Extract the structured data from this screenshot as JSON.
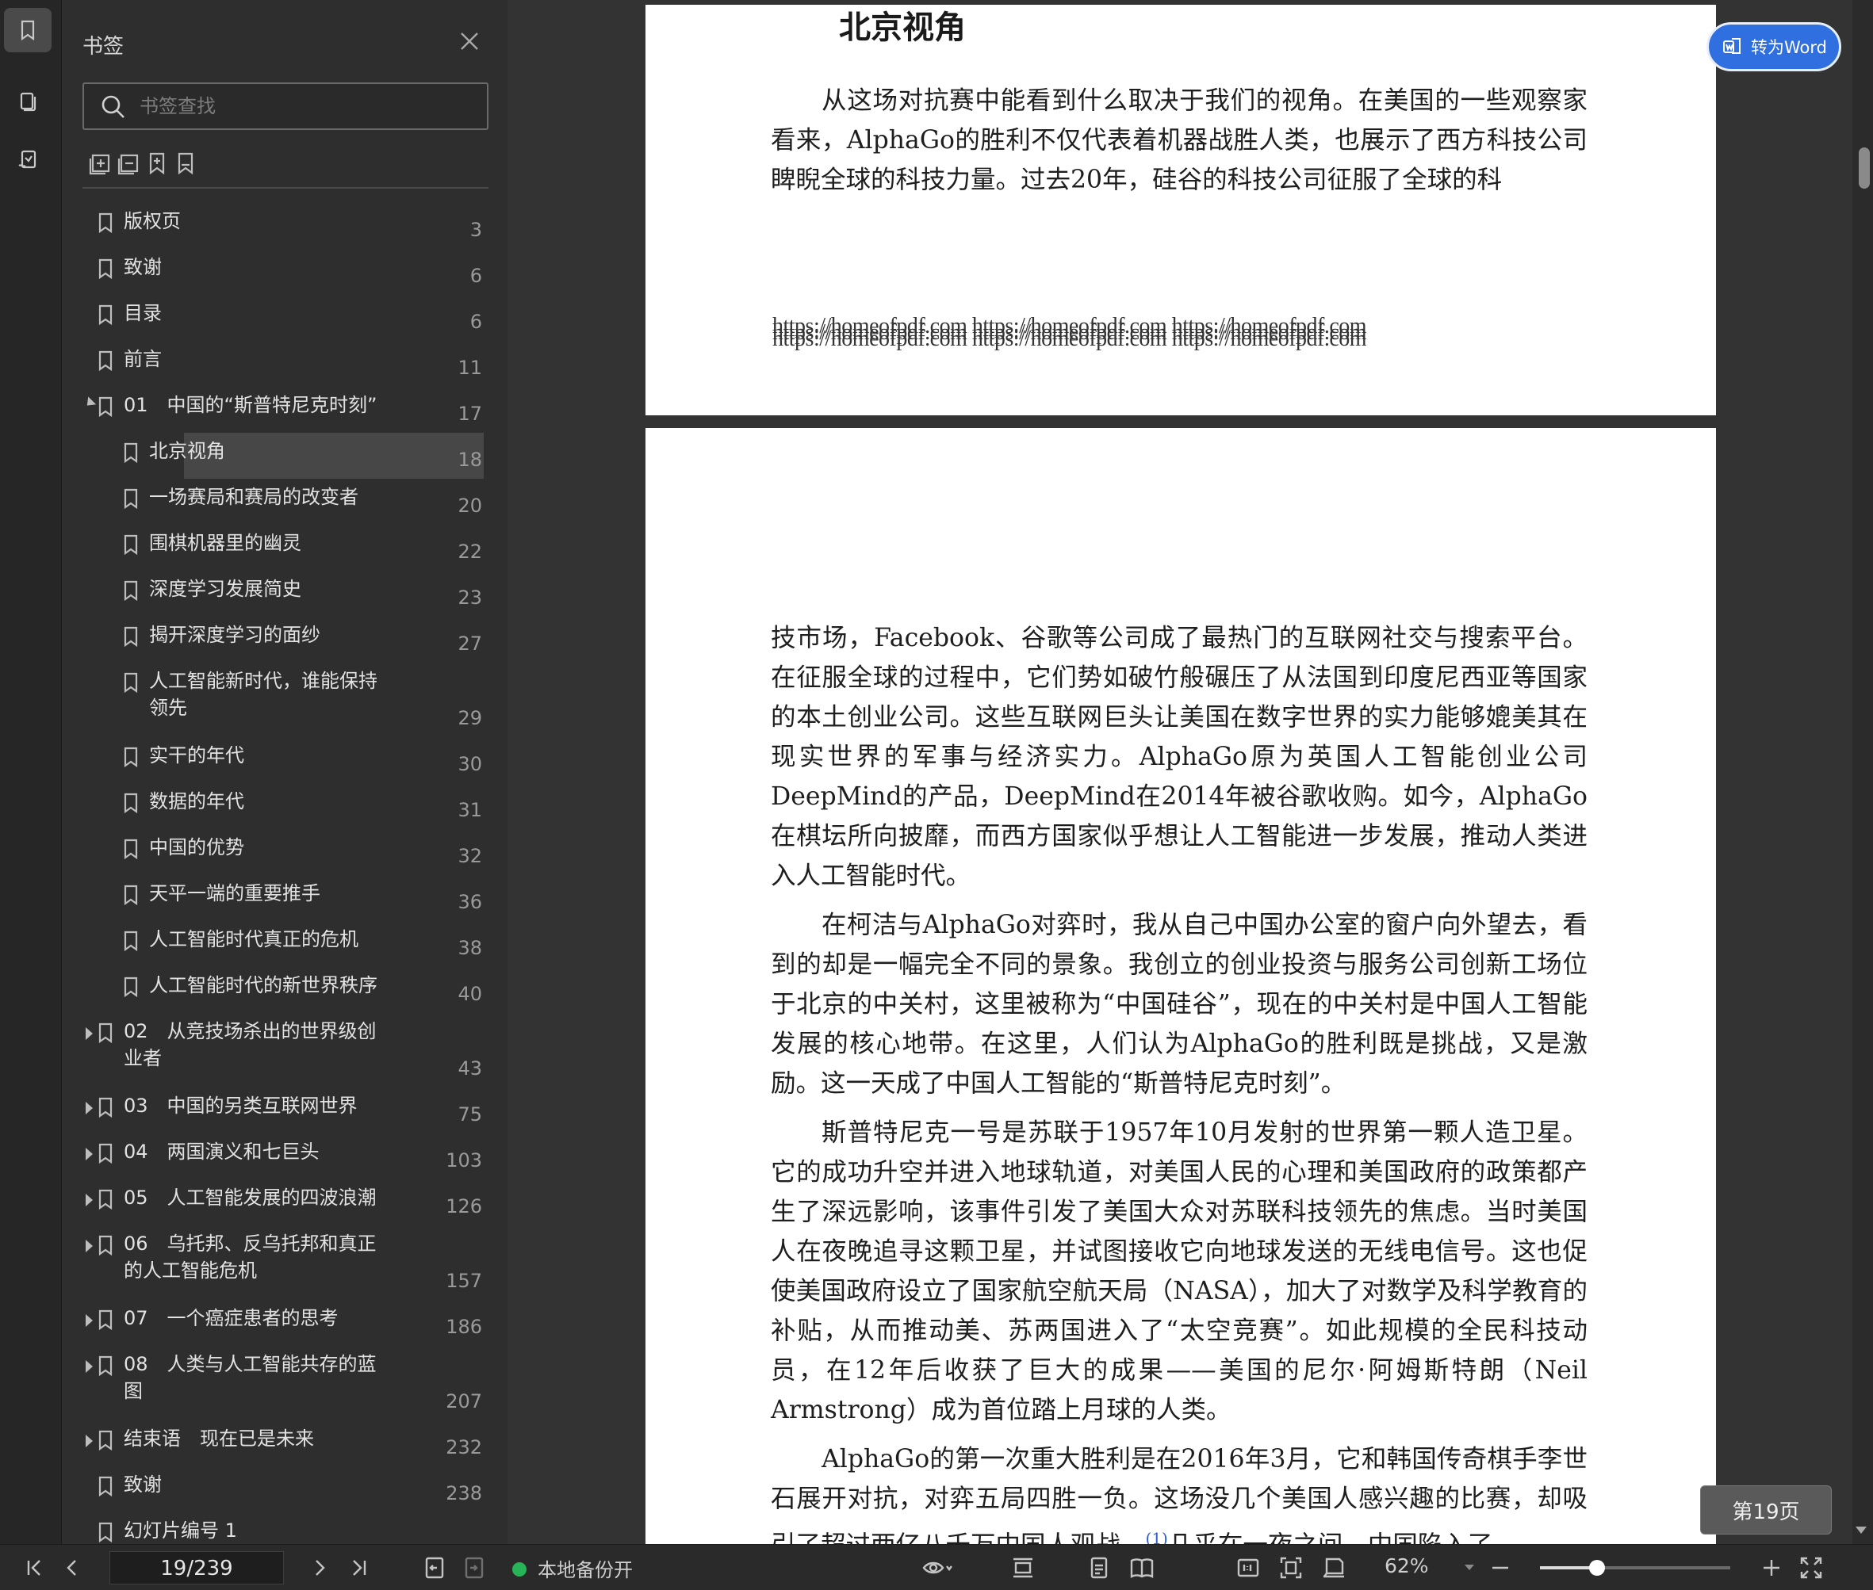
{
  "sidebar_rail": {
    "icons": [
      "bookmark-icon",
      "pages-icon",
      "annotation-icon"
    ]
  },
  "bookmarks_panel": {
    "title": "书签",
    "search_placeholder": "书签查找",
    "tools": [
      "expand-all-icon",
      "collapse-all-icon",
      "add-bookmark-icon",
      "bookmark-icon"
    ],
    "items": [
      {
        "label": "版权页",
        "page": "3"
      },
      {
        "label": "致谢",
        "page": "6"
      },
      {
        "label": "目录",
        "page": "6"
      },
      {
        "label": "前言",
        "page": "11"
      },
      {
        "label": "01　中国的“斯普特尼克时刻”",
        "page": "17"
      },
      {
        "label": "北京视角",
        "page": "18"
      },
      {
        "label": "一场赛局和赛局的改变者",
        "page": "20"
      },
      {
        "label": "围棋机器里的幽灵",
        "page": "22"
      },
      {
        "label": "深度学习发展简史",
        "page": "23"
      },
      {
        "label": "揭开深度学习的面纱",
        "page": "27"
      },
      {
        "label": "人工智能新时代，谁能保持领先",
        "page": "29"
      },
      {
        "label": "实干的年代",
        "page": "30"
      },
      {
        "label": "数据的年代",
        "page": "31"
      },
      {
        "label": "中国的优势",
        "page": "32"
      },
      {
        "label": "天平一端的重要推手",
        "page": "36"
      },
      {
        "label": "人工智能时代真正的危机",
        "page": "38"
      },
      {
        "label": "人工智能时代的新世界秩序",
        "page": "40"
      },
      {
        "label": "02　从竞技场杀出的世界级创业者",
        "page": "43"
      },
      {
        "label": "03　中国的另类互联网世界",
        "page": "75"
      },
      {
        "label": "04　两国演义和七巨头",
        "page": "103"
      },
      {
        "label": "05　人工智能发展的四波浪潮",
        "page": "126"
      },
      {
        "label": "06　乌托邦、反乌托邦和真正的人工智能危机",
        "page": "157"
      },
      {
        "label": "07　一个癌症患者的思考",
        "page": "186"
      },
      {
        "label": "08　人类与人工智能共存的蓝图",
        "page": "207"
      },
      {
        "label": "结束语　现在已是未来",
        "page": "232"
      },
      {
        "label": "致谢",
        "page": "238"
      },
      {
        "label": "幻灯片编号 1",
        "page": "..."
      }
    ]
  },
  "document": {
    "page1_heading": "北京视角",
    "page1_paragraph": "从这场对抗赛中能看到什么取决于我们的视角。在美国的一些观察家看来，AlphaGo的胜利不仅代表着机器战胜人类，也展示了西方科技公司睥睨全球的科技力量。过去20年，硅谷的科技公司征服了全球的科",
    "watermark_line1": "https://homeofpdf.com https://homeofpdf.com https://homeofpdf.com",
    "watermark_line2": "https://homeofpdf.com https://homeofpdf.com https://homeofpdf.com",
    "watermark_line3": "https://homeofpdf.com https://homeofpdf.com https://homeofpdf.com",
    "page2_para1": "技市场，Facebook、谷歌等公司成了最热门的互联网社交与搜索平台。在征服全球的过程中，它们势如破竹般碾压了从法国到印度尼西亚等国家的本土创业公司。这些互联网巨头让美国在数字世界的实力能够媲美其在现实世界的军事与经济实力。AlphaGo原为英国人工智能创业公司DeepMind的产品，DeepMind在2014年被谷歌收购。如今，AlphaGo在棋坛所向披靡，而西方国家似乎想让人工智能进一步发展，推动人类进入人工智能时代。",
    "page2_para2": "在柯洁与AlphaGo对弈时，我从自己中国办公室的窗户向外望去，看到的却是一幅完全不同的景象。我创立的创业投资与服务公司创新工场位于北京的中关村，这里被称为“中国硅谷”，现在的中关村是中国人工智能发展的核心地带。在这里，人们认为AlphaGo的胜利既是挑战，又是激励。这一天成了中国人工智能的“斯普特尼克时刻”。",
    "page2_para3": "斯普特尼克一号是苏联于1957年10月发射的世界第一颗人造卫星。它的成功升空并进入地球轨道，对美国人民的心理和美国政府的政策都产生了深远影响，该事件引发了美国大众对苏联科技领先的焦虑。当时美国人在夜晚追寻这颗卫星，并试图接收它向地球发送的无线电信号。这也促使美国政府设立了国家航空航天局（NASA），加大了对数学及科学教育的补贴，从而推动美、苏两国进入了“太空竞赛”。如此规模的全民科技动员，在12年后收获了巨大的成果——美国的尼尔·阿姆斯特朗（Neil Armstrong）成为首位踏上月球的人类。",
    "page2_para4a": "AlphaGo的第一次重大胜利是在2016年3月，它和韩国传奇棋手李世石展开对抗，对弈五局四胜一负。这场没几个美国人感兴趣的比赛，却吸引了超过两亿八千万中国人观战。",
    "page2_footnote": "(1)",
    "page2_para4b": "几乎在一夜之间，中国陷入了",
    "to_word_label": "转为Word",
    "page_tooltip": "第19页"
  },
  "bottom_toolbar": {
    "page_input_value": "19/239",
    "backup_label": "本地备份开",
    "backup_status_color": "#27b357",
    "zoom_value": "62%",
    "zoom_fraction": 0.3
  },
  "colors": {
    "accent": "#2f6fe0",
    "panel_bg": "#2e2e2e",
    "selected_row": "#474747"
  }
}
